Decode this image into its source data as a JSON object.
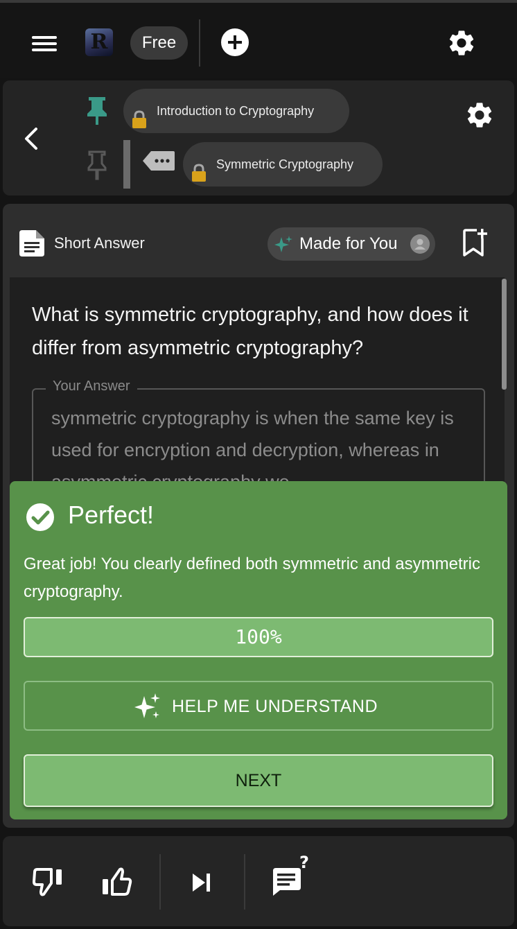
{
  "topbar": {
    "logo_letter": "R",
    "plan_label": "Free",
    "icons": [
      "menu-icon",
      "plus-circle-icon",
      "gear-icon"
    ]
  },
  "breadcrumb": {
    "crumbs": [
      {
        "label": "Introduction to Cryptography",
        "locked": true,
        "pinned": true
      },
      {
        "label": "Symmetric Cryptography",
        "locked": true,
        "pinned": false
      }
    ],
    "icons": [
      "back-arrow-icon",
      "pin-icon",
      "more-tag-icon",
      "lock-icon",
      "gear-icon"
    ]
  },
  "question_card": {
    "type_label": "Short Answer",
    "made_for_you_label": "Made for You",
    "question": "What is symmetric cryptography, and how does it differ from asymmetric cryptography?",
    "answer_legend": "Your Answer",
    "answer_text": "symmetric cryptography is when the same key is used for encryption and decryption, whereas in asymmetric cryptography we"
  },
  "feedback": {
    "title": "Perfect!",
    "message": "Great job! You clearly defined both symmetric and asymmetric cryptography.",
    "score": "100%",
    "help_label": "HELP ME UNDERSTAND",
    "next_label": "NEXT",
    "color": "#58924a"
  },
  "bottombar": {
    "icons": [
      "thumbs-down-icon",
      "thumbs-up-icon",
      "skip-next-icon",
      "question-chat-icon"
    ]
  },
  "colors": {
    "background": "#141414",
    "accent_teal": "#3a9a88",
    "success_green": "#58924a"
  }
}
